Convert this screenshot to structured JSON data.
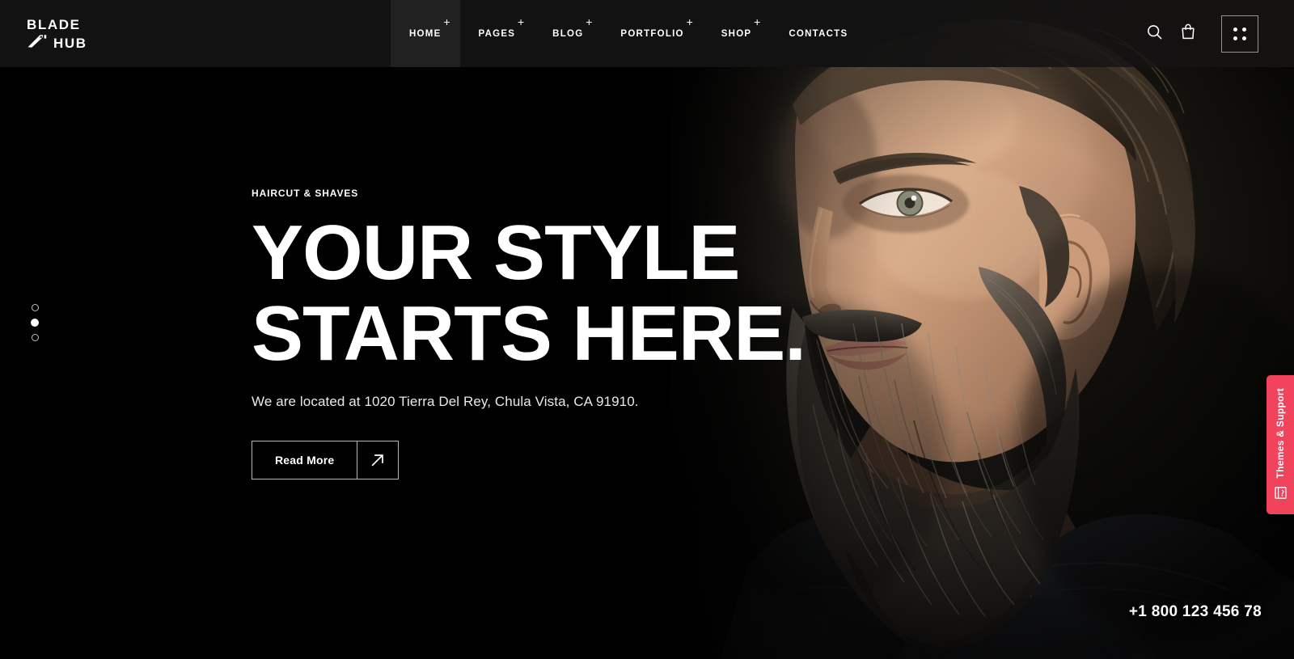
{
  "site": {
    "logo_line1": "BLADE",
    "logo_line2": "HUB",
    "logo_icon": "razor-blade-icon"
  },
  "header": {
    "nav": [
      {
        "label": "HOME",
        "has_submenu": true,
        "active": true
      },
      {
        "label": "PAGES",
        "has_submenu": true,
        "active": false
      },
      {
        "label": "BLOG",
        "has_submenu": true,
        "active": false
      },
      {
        "label": "PORTFOLIO",
        "has_submenu": true,
        "active": false
      },
      {
        "label": "SHOP",
        "has_submenu": true,
        "active": false
      },
      {
        "label": "CONTACTS",
        "has_submenu": false,
        "active": false
      }
    ],
    "submenu_marker": "+",
    "actions": {
      "search_icon": "search-icon",
      "cart_icon": "shopping-bag-icon",
      "grid_menu_icon": "grid-dots-icon"
    }
  },
  "hero": {
    "eyebrow": "HAIRCUT & SHAVES",
    "headline_line1": "YOUR STYLE",
    "headline_line2": "STARTS HERE.",
    "subline": "We are located at 1020 Tierra Del Rey, Chula Vista, CA 91910.",
    "cta_label": "Read More",
    "cta_icon": "arrow-up-right-icon",
    "image_alt": "bearded-man-portrait"
  },
  "slider": {
    "dots": [
      {
        "index": 1,
        "active": false
      },
      {
        "index": 2,
        "active": true
      },
      {
        "index": 3,
        "active": false
      }
    ]
  },
  "contact": {
    "phone": "+1 800 123 456 78"
  },
  "support_tab": {
    "label": "Themes & Support",
    "icon": "book-support-icon",
    "color": "#f2435c"
  },
  "colors": {
    "page_background": "#000000",
    "header_background": "#121212",
    "nav_active_background": "#212121",
    "text_primary": "#ffffff",
    "accent": "#f2435c"
  }
}
